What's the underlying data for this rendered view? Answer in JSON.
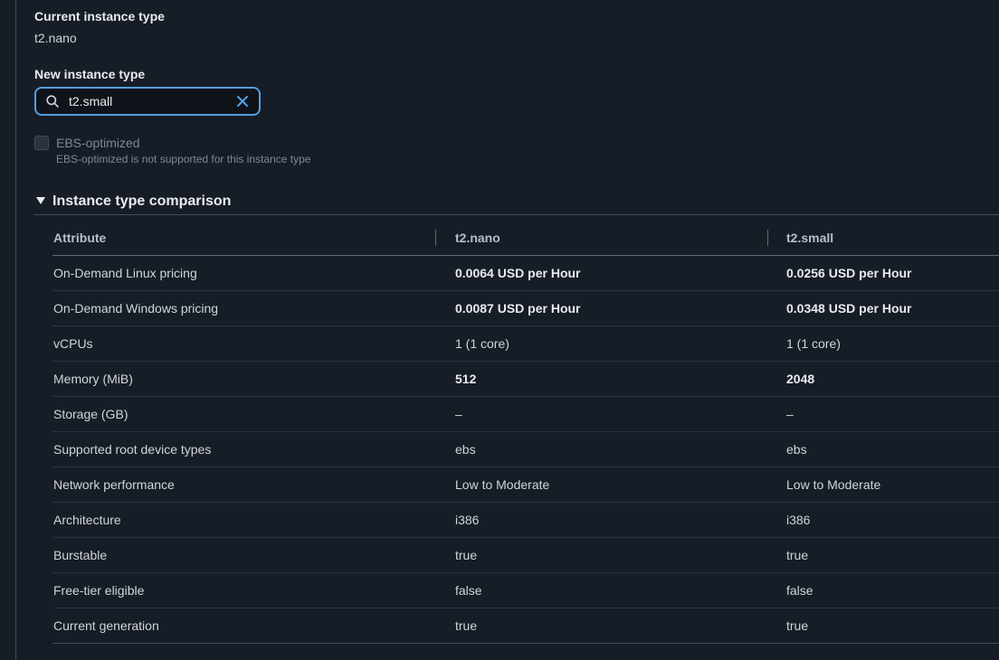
{
  "current_type": {
    "label": "Current instance type",
    "value": "t2.nano"
  },
  "new_type": {
    "label": "New instance type",
    "input_value": "t2.small"
  },
  "ebs": {
    "label": "EBS-optimized",
    "description": "EBS-optimized is not supported for this instance type",
    "checked": false,
    "disabled": true
  },
  "comparison": {
    "title": "Instance type comparison",
    "expanded": true,
    "columns": [
      "Attribute",
      "t2.nano",
      "t2.small"
    ],
    "rows": [
      {
        "attribute": "On-Demand Linux pricing",
        "a": "0.0064 USD per Hour",
        "b": "0.0256 USD per Hour",
        "bold": true
      },
      {
        "attribute": "On-Demand Windows pricing",
        "a": "0.0087 USD per Hour",
        "b": "0.0348 USD per Hour",
        "bold": true
      },
      {
        "attribute": "vCPUs",
        "a": "1 (1 core)",
        "b": "1 (1 core)",
        "bold": false
      },
      {
        "attribute": "Memory (MiB)",
        "a": "512",
        "b": "2048",
        "bold": true
      },
      {
        "attribute": "Storage (GB)",
        "a": "–",
        "b": "–",
        "bold": false
      },
      {
        "attribute": "Supported root device types",
        "a": "ebs",
        "b": "ebs",
        "bold": false
      },
      {
        "attribute": "Network performance",
        "a": "Low to Moderate",
        "b": "Low to Moderate",
        "bold": false
      },
      {
        "attribute": "Architecture",
        "a": "i386",
        "b": "i386",
        "bold": false
      },
      {
        "attribute": "Burstable",
        "a": "true",
        "b": "true",
        "bold": false
      },
      {
        "attribute": "Free-tier eligible",
        "a": "false",
        "b": "false",
        "bold": false
      },
      {
        "attribute": "Current generation",
        "a": "true",
        "b": "true",
        "bold": false
      }
    ]
  },
  "icons": {
    "search": "search-icon",
    "clear": "close-icon",
    "caret": "caret-down-icon"
  },
  "colors": {
    "background": "#161d26",
    "accent": "#539fe5",
    "text": "#d1d5db"
  }
}
